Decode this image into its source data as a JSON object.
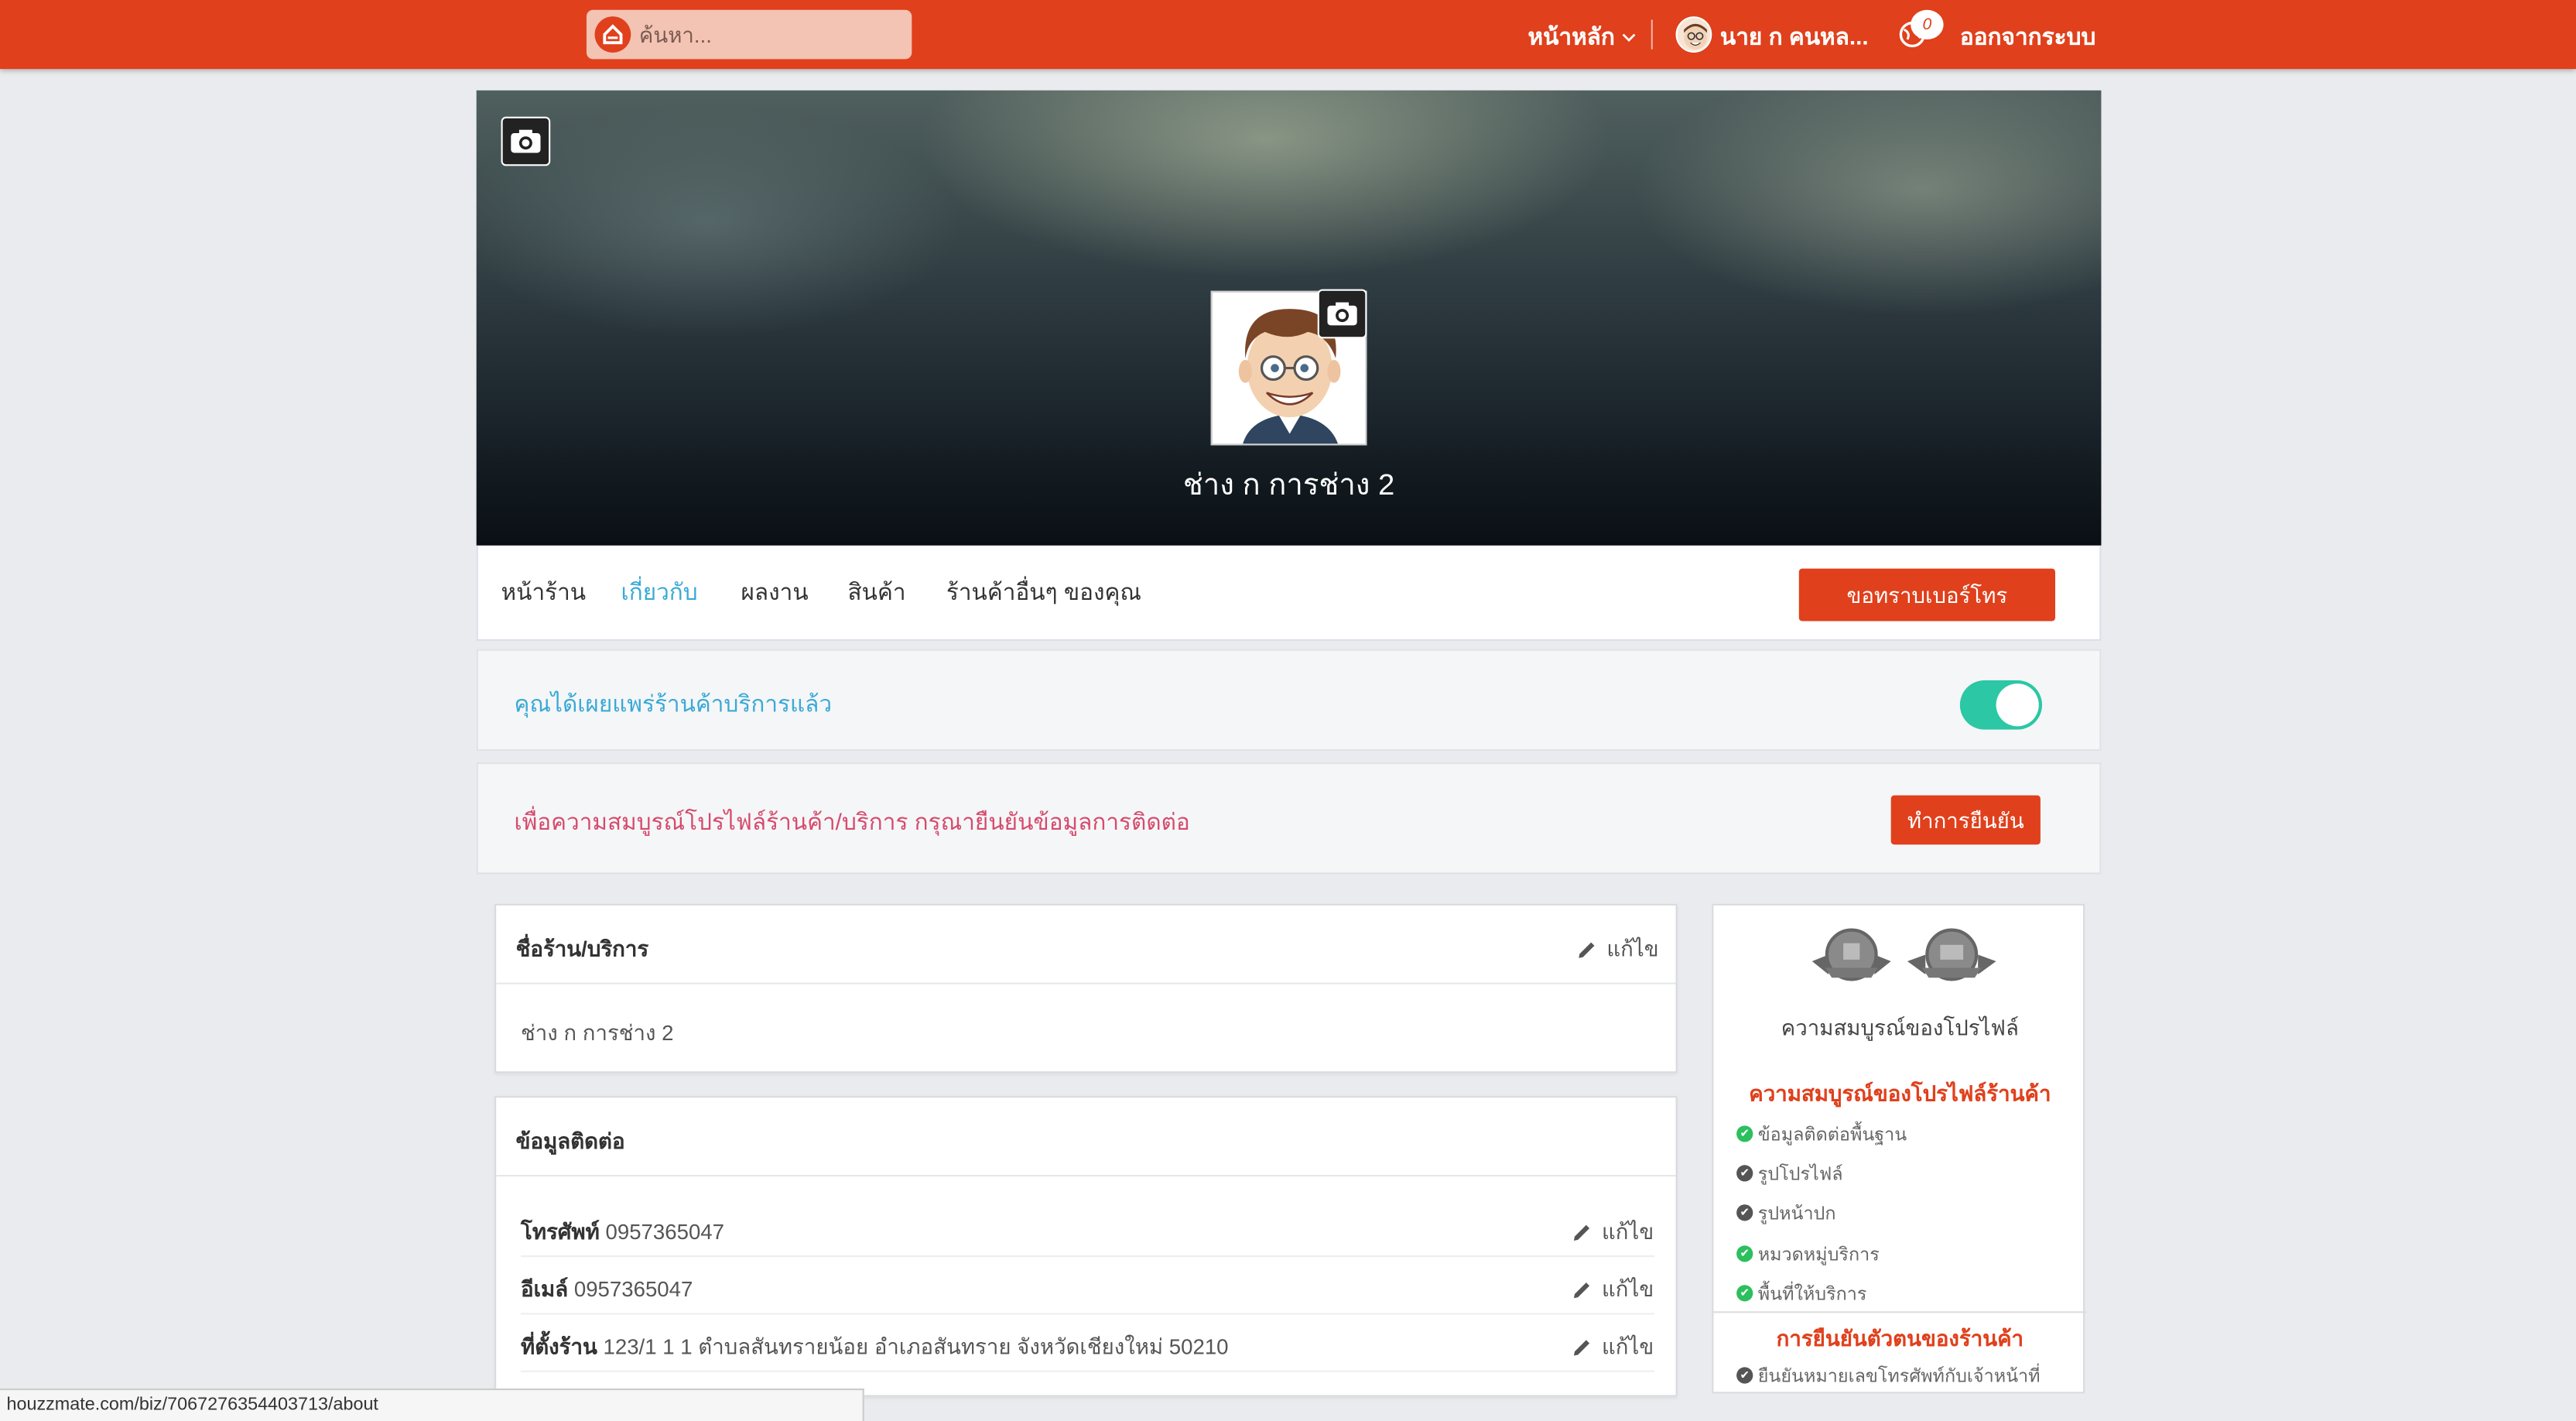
{
  "header": {
    "search_placeholder": "ค้นหา...",
    "home": "หน้าหลัก",
    "user": "นาย ก คนหล...",
    "notif_count": "0",
    "logout": "ออกจากระบบ",
    "brand_color": "#e0401c"
  },
  "profile": {
    "name": "ช่าง ก การช่าง 2"
  },
  "tabs": [
    {
      "label": "หน้าร้าน",
      "active": false
    },
    {
      "label": "เกี่ยวกับ",
      "active": true
    },
    {
      "label": "ผลงาน",
      "active": false
    },
    {
      "label": "สินค้า",
      "active": false
    },
    {
      "label": "ร้านค้าอื่นๆ ของคุณ",
      "active": false
    }
  ],
  "actions": {
    "ask_phone": "ขอทราบเบอร์โทร",
    "verify": "ทำการยืนยัน"
  },
  "notices": {
    "published": "คุณได้เผยแพร่ร้านค้าบริการแล้ว",
    "published_toggle": true,
    "verify_prompt": "เพื่อความสมบูรณ์โปรไฟล์ร้านค้า/บริการ กรุณายืนยันข้อมูลการติดต่อ"
  },
  "shop_card": {
    "title": "ชื่อร้าน/บริการ",
    "edit": "แก้ไข",
    "value": "ช่าง ก การช่าง 2"
  },
  "contact_card": {
    "title": "ข้อมูลติดต่อ",
    "rows": [
      {
        "label": "โทรศัพท์",
        "value": "0957365047",
        "edit": "แก้ไข"
      },
      {
        "label": "อีเมล์",
        "value": "0957365047",
        "edit": "แก้ไข"
      },
      {
        "label": "ที่ตั้งร้าน",
        "value": "123/1 1 1 ตำบลสันทรายน้อย อำเภอสันทราย จังหวัดเชียงใหม่ 50210",
        "edit": "แก้ไข"
      }
    ]
  },
  "sidebar": {
    "title": "ความสมบูรณ์ของโปรไฟล์",
    "subtitle": "ความสมบูรณ์ของโปรไฟล์ร้านค้า",
    "checklist": [
      {
        "label": "ข้อมูลติดต่อพื้นฐาน",
        "done": true
      },
      {
        "label": "รูปโปรไฟล์",
        "done": false
      },
      {
        "label": "รูปหน้าปก",
        "done": false
      },
      {
        "label": "หมวดหมู่บริการ",
        "done": true
      },
      {
        "label": "พื้นที่ให้บริการ",
        "done": true
      }
    ],
    "subtitle2": "การยืนยันตัวตนของร้านค้า",
    "verify_item": "ยืนยันหมายเลขโทรศัพท์กับเจ้าหน้าที่"
  },
  "statusbar": {
    "url": "houzzmate.com/biz/7067276354403713/about"
  }
}
